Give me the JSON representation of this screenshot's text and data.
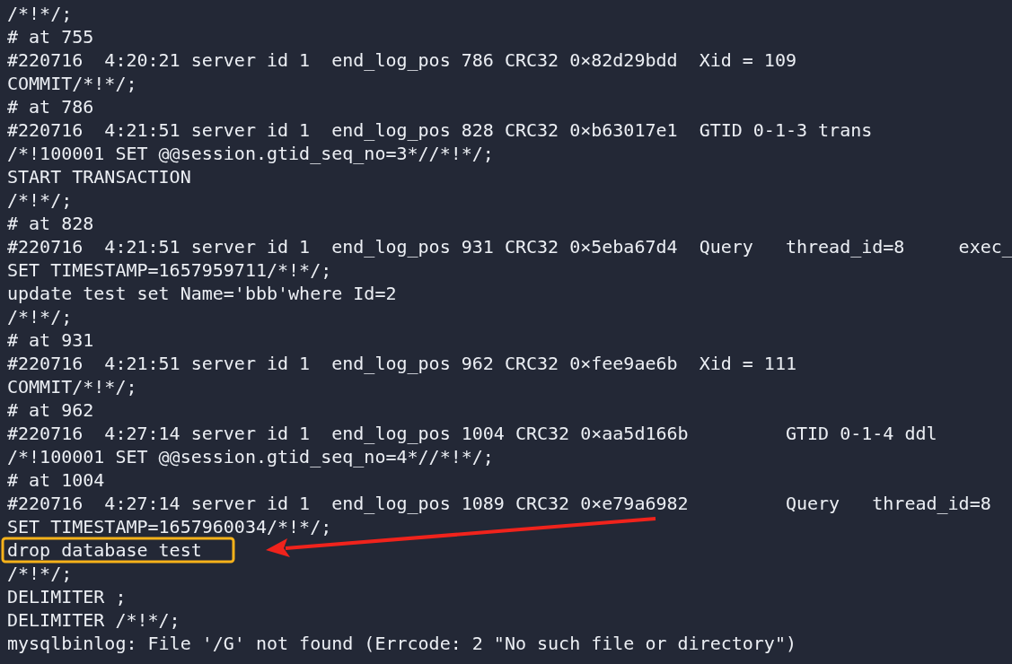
{
  "terminal": {
    "lines": [
      "/*!*/;",
      "# at 755",
      "#220716  4:20:21 server id 1  end_log_pos 786 CRC32 0×82d29bdd  Xid = 109",
      "COMMIT/*!*/;",
      "# at 786",
      "#220716  4:21:51 server id 1  end_log_pos 828 CRC32 0×b63017e1  GTID 0-1-3 trans",
      "/*!100001 SET @@session.gtid_seq_no=3*//*!*/;",
      "START TRANSACTION",
      "/*!*/;",
      "# at 828",
      "#220716  4:21:51 server id 1  end_log_pos 931 CRC32 0×5eba67d4  Query   thread_id=8     exec_",
      "SET TIMESTAMP=1657959711/*!*/;",
      "update test set Name='bbb'where Id=2",
      "/*!*/;",
      "# at 931",
      "#220716  4:21:51 server id 1  end_log_pos 962 CRC32 0×fee9ae6b  Xid = 111",
      "COMMIT/*!*/;",
      "# at 962",
      "#220716  4:27:14 server id 1  end_log_pos 1004 CRC32 0×aa5d166b         GTID 0-1-4 ddl",
      "/*!100001 SET @@session.gtid_seq_no=4*//*!*/;",
      "# at 1004",
      "#220716  4:27:14 server id 1  end_log_pos 1089 CRC32 0×e79a6982         Query   thread_id=8",
      "SET TIMESTAMP=1657960034/*!*/;",
      "drop database test",
      "/*!*/;",
      "DELIMITER ;",
      "DELIMITER /*!*/;",
      "mysqlbinlog: File '/G' not found (Errcode: 2 \"No such file or directory\")"
    ]
  },
  "annotations": [
    {
      "kind": "highlight-box",
      "color": "#f7b21a"
    },
    {
      "kind": "arrow",
      "color": "#f0231c"
    }
  ]
}
